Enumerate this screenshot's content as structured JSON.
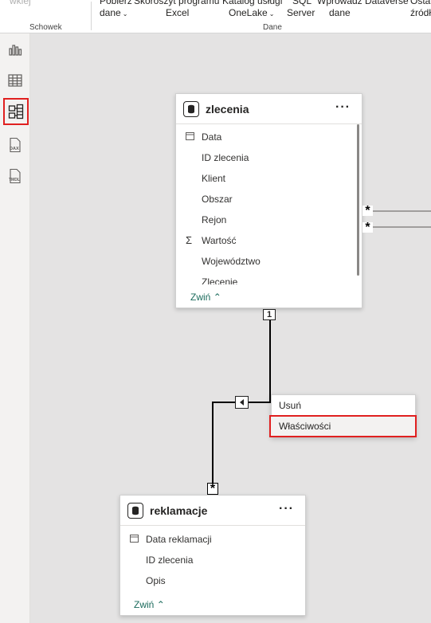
{
  "ribbon": {
    "truncated_label": "wkiej",
    "clipboard_group": "Schowek",
    "data_group": "Dane",
    "buttons": [
      {
        "line1": "Pobierz",
        "line2": "dane"
      },
      {
        "line1": "Skoroszyt programu",
        "line2": "Excel"
      },
      {
        "line1": "Katalog usługi",
        "line2": "OneLake"
      },
      {
        "line1": "SQL",
        "line2": "Server"
      },
      {
        "line1": "Wprowadź",
        "line2": "dane"
      },
      {
        "line1": "Dataverse",
        "line2": ""
      },
      {
        "line1": "Osta",
        "line2": "źródł"
      }
    ]
  },
  "nav": {
    "items": [
      {
        "name": "report-view",
        "icon": "bar-chart-icon"
      },
      {
        "name": "table-view",
        "icon": "table-grid-icon"
      },
      {
        "name": "model-view",
        "icon": "model-diagram-icon",
        "selected": true
      },
      {
        "name": "dax-query-view",
        "icon": "dax-icon",
        "label": "DAX"
      },
      {
        "name": "tmdl-view",
        "icon": "tmdl-icon",
        "label": "TMDL"
      }
    ]
  },
  "tables": {
    "zlecenia": {
      "title": "zlecenia",
      "more": "···",
      "fields": [
        "Data",
        "ID zlecenia",
        "Klient",
        "Obszar",
        "Rejon",
        "Wartość",
        "Województwo",
        "Zlecenie"
      ],
      "field_icons": {
        "Data": "calendar-icon",
        "Wartość": "sigma-icon"
      },
      "collapse": "Zwiń"
    },
    "reklamacje": {
      "title": "reklamacje",
      "more": "···",
      "fields": [
        "Data reklamacji",
        "ID zlecenia",
        "Opis"
      ],
      "field_icons": {
        "Data reklamacji": "calendar-icon"
      },
      "collapse": "Zwiń"
    }
  },
  "relationships": {
    "one_marker": "1",
    "many_marker": "*",
    "direction_icon": "arrow-left-icon"
  },
  "context_menu": {
    "items": [
      {
        "label": "Usuń",
        "highlighted": false
      },
      {
        "label": "Właściwości",
        "highlighted": true
      }
    ]
  },
  "colors": {
    "accent_highlight": "#e02020",
    "link": "#1b6b5c",
    "canvas": "#e4e3e3"
  }
}
